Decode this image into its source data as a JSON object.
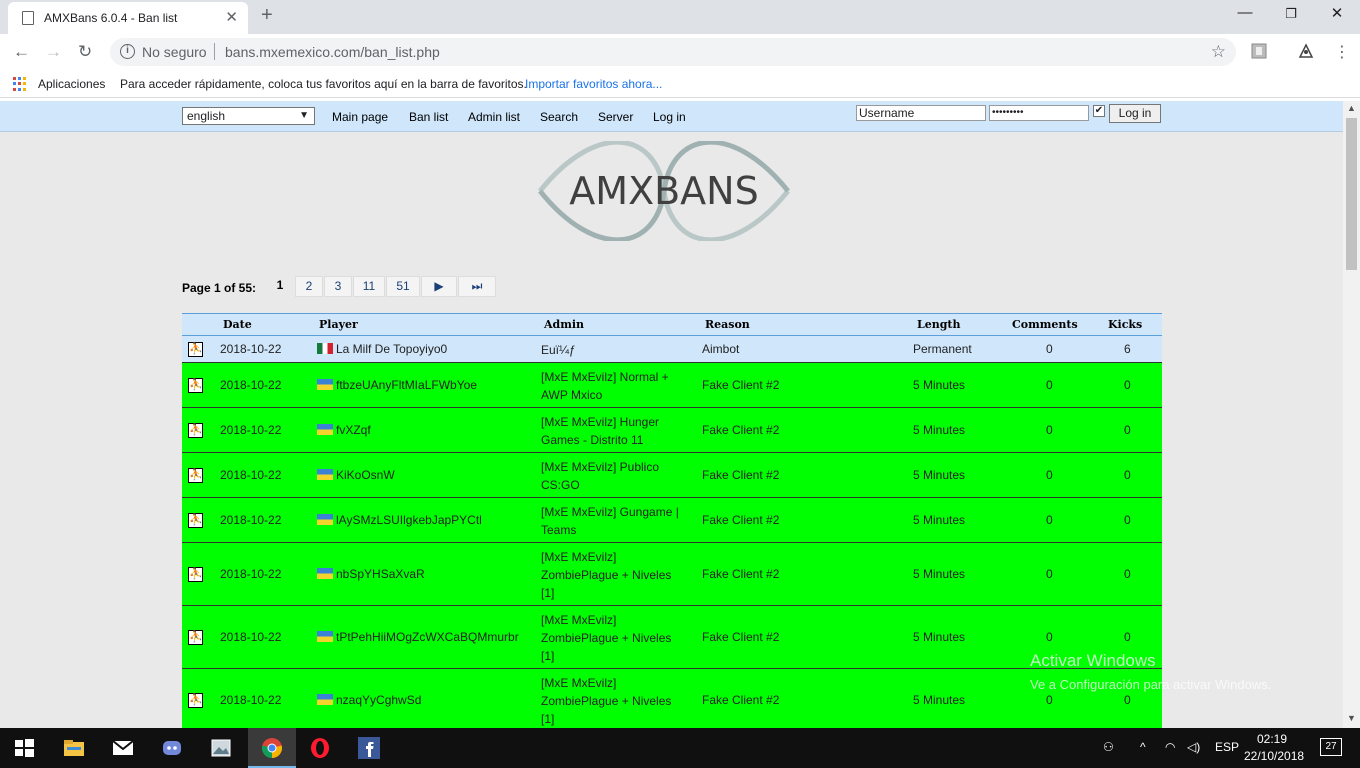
{
  "browser": {
    "tab_title": "AMXBans 6.0.4 - Ban list",
    "security_label": "No seguro",
    "url": "bans.mxemexico.com/ban_list.php",
    "bookmarks_apps": "Aplicaciones",
    "bookmarks_message": "Para acceder rápidamente, coloca tus favoritos aquí en la barra de favoritos.",
    "bookmarks_import": "Importar favoritos ahora..."
  },
  "menu": {
    "language": "english",
    "links": [
      "Main page",
      "Ban list",
      "Admin list",
      "Search",
      "Server",
      "Log in"
    ],
    "username_placeholder": "Username",
    "password_mask": "•••••••••",
    "remember_checked": "✔",
    "login_button": "Log in"
  },
  "logo_text": "AMXBANS",
  "pager": {
    "label": "Page 1 of 55:",
    "current": "1",
    "pages": [
      "2",
      "3",
      "11",
      "51"
    ],
    "next_icon": "next-page-icon",
    "last_icon": "last-page-icon"
  },
  "table": {
    "headers": [
      "Date",
      "Player",
      "Admin",
      "Reason",
      "Length",
      "Comments",
      "Kicks"
    ],
    "rows": [
      {
        "date": "2018-10-22",
        "flag": "mx",
        "player": "La Milf De Topoyiyo0",
        "admin": [
          "Euï¼ƒ"
        ],
        "reason": "Aimbot",
        "length": "Permanent",
        "comments": "0",
        "kicks": "6"
      },
      {
        "date": "2018-10-22",
        "flag": "ua",
        "player": "ftbzeUAnyFltMIaLFWbYoe",
        "admin": [
          "[MxE MxEvilz] Normal +",
          "AWP Mxico"
        ],
        "reason": "Fake Client #2",
        "length": "5 Minutes",
        "comments": "0",
        "kicks": "0"
      },
      {
        "date": "2018-10-22",
        "flag": "ua",
        "player": "fvXZqf",
        "admin": [
          "[MxE MxEvilz] Hunger",
          "Games - Distrito 11"
        ],
        "reason": "Fake Client #2",
        "length": "5 Minutes",
        "comments": "0",
        "kicks": "0"
      },
      {
        "date": "2018-10-22",
        "flag": "ua",
        "player": "KiKoOsnW",
        "admin": [
          "[MxE MxEvilz] Publico",
          "CS:GO"
        ],
        "reason": "Fake Client #2",
        "length": "5 Minutes",
        "comments": "0",
        "kicks": "0"
      },
      {
        "date": "2018-10-22",
        "flag": "ua",
        "player": "lAySMzLSUIlgkebJapPYCtl",
        "admin": [
          "[MxE MxEvilz] Gungame |",
          "Teams"
        ],
        "reason": "Fake Client #2",
        "length": "5 Minutes",
        "comments": "0",
        "kicks": "0"
      },
      {
        "date": "2018-10-22",
        "flag": "ua",
        "player": "nbSpYHSaXvaR",
        "admin": [
          "[MxE MxEvilz]",
          "ZombiePlague + Niveles",
          "[1]"
        ],
        "reason": "Fake Client #2",
        "length": "5 Minutes",
        "comments": "0",
        "kicks": "0"
      },
      {
        "date": "2018-10-22",
        "flag": "ua",
        "player": "tPtPehHiiMOgZcWXCaBQMmurbr",
        "admin": [
          "[MxE MxEvilz]",
          "ZombiePlague + Niveles",
          "[1]"
        ],
        "reason": "Fake Client #2",
        "length": "5 Minutes",
        "comments": "0",
        "kicks": "0"
      },
      {
        "date": "2018-10-22",
        "flag": "ua",
        "player": "nzaqYyCghwSd",
        "admin": [
          "[MxE MxEvilz]",
          "ZombiePlague + Niveles",
          "[1]"
        ],
        "reason": "Fake Client #2",
        "length": "5 Minutes",
        "comments": "0",
        "kicks": "0"
      }
    ]
  },
  "watermark": {
    "line1": "Activar Windows",
    "line2": "Ve a Configuración para activar Windows."
  },
  "taskbar": {
    "lang": "ESP",
    "time": "02:19",
    "date": "22/10/2018",
    "notifications": "27"
  },
  "colors": {
    "menubar": "#cfe6fb",
    "row_green": "#00ff00",
    "page_bg": "#e9e9e9"
  }
}
